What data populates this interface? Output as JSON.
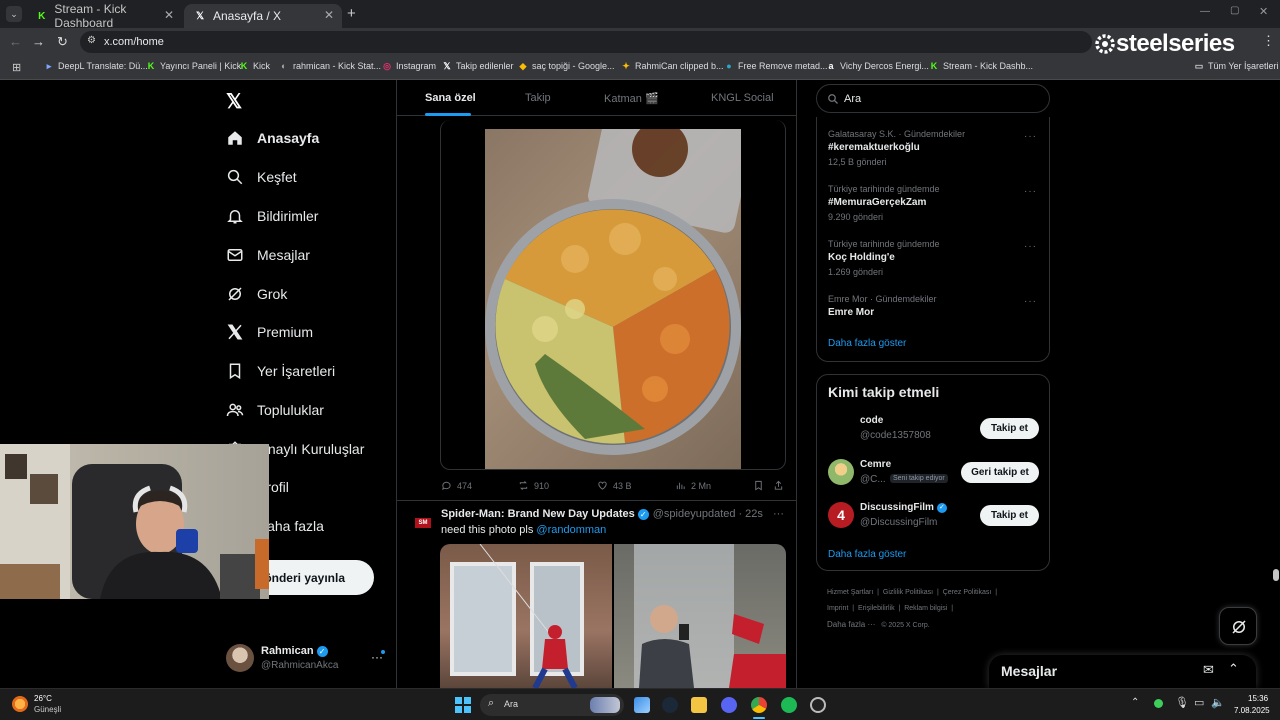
{
  "browser": {
    "tabs": [
      {
        "title": "Stream - Kick Dashboard",
        "active": false
      },
      {
        "title": "Anasayfa / X",
        "active": true
      }
    ],
    "url": "x.com/home",
    "bookmarks": [
      "DeepL Translate: Dü...",
      "Yayıncı Paneli | Kick",
      "Kick",
      "rahmican - Kick Stat...",
      "Instagram",
      "Takip edilenler",
      "saç topiği - Google...",
      "RahmiCan clipped b...",
      "Free Remove metad...",
      "Vichy Dercos Energi...",
      "Stream - Kick Dashb..."
    ],
    "all_bookmarks": "Tüm Yer İşaretleri",
    "overlay_brand": "steelseries"
  },
  "nav": {
    "items": [
      {
        "label": "Anasayfa",
        "icon": "home-icon"
      },
      {
        "label": "Keşfet",
        "icon": "search-icon"
      },
      {
        "label": "Bildirimler",
        "icon": "bell-icon"
      },
      {
        "label": "Mesajlar",
        "icon": "mail-icon"
      },
      {
        "label": "Grok",
        "icon": "grok-icon"
      },
      {
        "label": "Premium",
        "icon": "x-icon"
      },
      {
        "label": "Yer İşaretleri",
        "icon": "bookmark-icon"
      },
      {
        "label": "Topluluklar",
        "icon": "community-icon"
      },
      {
        "label": "Onaylı Kuruluşlar",
        "icon": "verified-org-icon"
      },
      {
        "label": "Profil",
        "icon": "profile-icon"
      },
      {
        "label": "Daha fazla",
        "icon": "more-icon"
      }
    ],
    "post_button": "Gönderi yayınla",
    "user": {
      "name": "Rahmican",
      "handle": "@RahmicanAkca"
    }
  },
  "feed": {
    "tabs": [
      "Sana özel",
      "Takip",
      "Katman 🎬",
      "KNGL Social"
    ],
    "post1": {
      "replies": "474",
      "reposts": "910",
      "likes": "43 B",
      "views": "2 Mn"
    },
    "post2": {
      "author": "Spider-Man: Brand New Day Updates",
      "handle": "@spideyupdated",
      "time": "22s",
      "text": "need this photo pls",
      "mention": "@randomman"
    }
  },
  "right": {
    "search_placeholder": "Ara",
    "trends": [
      {
        "meta": "Galatasaray S.K. · Gündemdekiler",
        "name": "#keremaktuerkoğlu",
        "count": "12,5 B gönderi"
      },
      {
        "meta": "Türkiye tarihinde gündemde",
        "name": "#MemuraGerçekZam",
        "count": "9.290 gönderi"
      },
      {
        "meta": "Türkiye tarihinde gündemde",
        "name": "Koç Holding'e",
        "count": "1.269 gönderi"
      },
      {
        "meta": "Emre Mor · Gündemdekiler",
        "name": "Emre Mor",
        "count": ""
      }
    ],
    "show_more": "Daha fazla göster",
    "who_to_follow_title": "Kimi takip etmeli",
    "follow": [
      {
        "name": "code",
        "handle": "@code1357808",
        "button": "Takip et",
        "badge": ""
      },
      {
        "name": "Cemre",
        "handle": "@C...",
        "button": "Geri takip et",
        "badge": "Seni takip ediyor"
      },
      {
        "name": "DiscussingFilm",
        "handle": "@DiscussingFilm",
        "button": "Takip et",
        "badge": ""
      }
    ],
    "footer": [
      "Hizmet Şartları",
      "Gizlilik Politikası",
      "Çerez Politikası",
      "Imprint",
      "Erişilebilirlik",
      "Reklam bilgisi",
      "Daha fazla ···",
      "© 2025 X Corp."
    ],
    "messages_title": "Mesajlar"
  },
  "taskbar": {
    "weather_temp": "26°C",
    "weather_desc": "Güneşli",
    "search": "Ara",
    "time": "15:36",
    "date": "7.08.2025"
  },
  "colors": {
    "accent": "#1d9bf0",
    "bg": "#000000",
    "border": "#2f3336"
  }
}
